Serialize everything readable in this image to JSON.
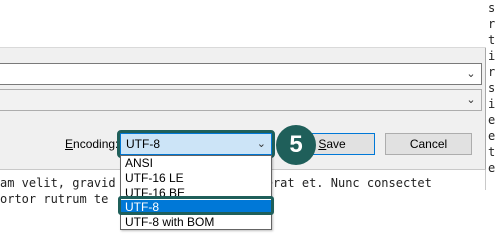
{
  "dialog": {
    "encoding_label_prefix": "",
    "encoding_label_underline": "E",
    "encoding_label_rest": "ncoding:",
    "encoding_value": "UTF-8",
    "save_label_underline": "S",
    "save_label_rest": "ave",
    "cancel_label": "Cancel"
  },
  "encoding_options": [
    "ANSI",
    "UTF-16 LE",
    "UTF-16 BE",
    "UTF-8",
    "UTF-8 with BOM"
  ],
  "selected_option": "UTF-8",
  "step_badge": "5",
  "background_editor": {
    "right_edge_chars": [
      "s",
      "r",
      "t",
      "i",
      "r",
      "s",
      "i",
      "e",
      "e",
      "t",
      "e"
    ],
    "line1": "am velit, gravid",
    "line1_after": " placerat et. Nunc consectet",
    "line2_start": "ortor rutrum te",
    "line2_end": ""
  },
  "colors": {
    "accent": "#0078d7",
    "callout": "#1f5f5a",
    "selection_bg": "#0078d7",
    "combo_focus_bg": "#cce4f7"
  }
}
